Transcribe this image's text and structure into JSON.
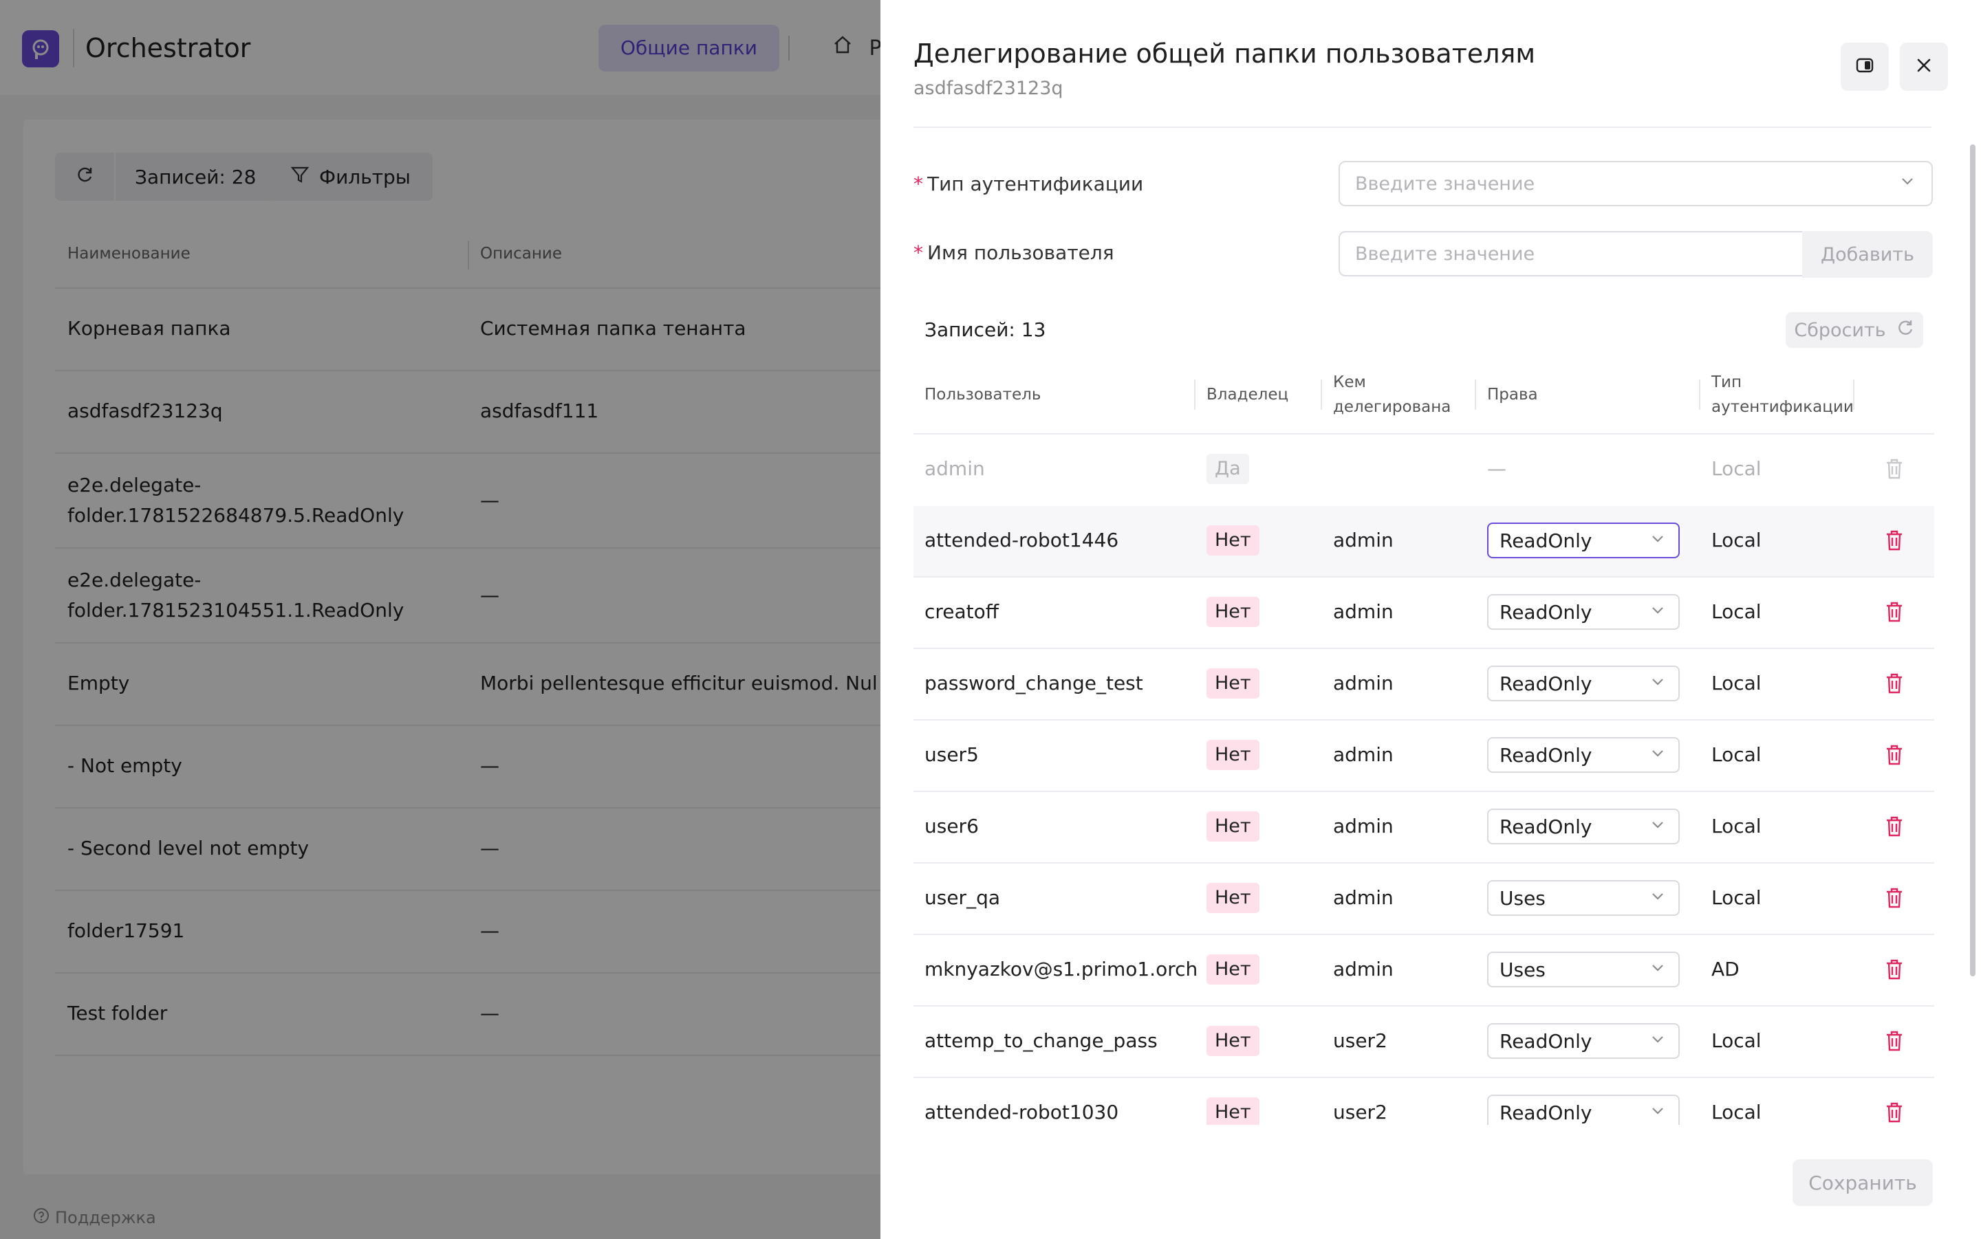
{
  "app": {
    "brand": "Orchestrator",
    "nav_active": "Общие папки",
    "nav_home_partial": "Р",
    "toolbar": {
      "records": "Записей: 28",
      "filters": "Фильтры"
    },
    "table": {
      "col_name": "Наименование",
      "col_desc": "Описание",
      "rows": [
        {
          "name": "Корневая папка",
          "desc": "Системная папка тенанта"
        },
        {
          "name": "asdfasdf23123q",
          "desc": "asdfasdf111"
        },
        {
          "name": "e2e.delegate-folder.1781522684879.5.ReadOnly",
          "desc": "—"
        },
        {
          "name": "e2e.delegate-folder.1781523104551.1.ReadOnly",
          "desc": "—"
        },
        {
          "name": "Empty",
          "desc": "Morbi pellentesque efficitur euismod. Nullam p"
        },
        {
          "name": "- Not empty",
          "desc": "—"
        },
        {
          "name": "- Second level not empty",
          "desc": "—"
        },
        {
          "name": "folder17591",
          "desc": "—"
        },
        {
          "name": "Test folder",
          "desc": "—"
        }
      ]
    },
    "support": "Поддержка"
  },
  "drawer": {
    "title": "Делегирование общей папки пользователям",
    "subtitle": "asdfasdf23123q",
    "form": {
      "auth_label": "Тип аутентификации",
      "auth_placeholder": "Введите значение",
      "user_label": "Имя пользователя",
      "user_placeholder": "Введите значение",
      "add_label": "Добавить"
    },
    "records": "Записей: 13",
    "reset_label": "Сбросить",
    "columns": {
      "user": "Пользователь",
      "owner": "Владелец",
      "delegated_1": "Кем",
      "delegated_2": "делегирована",
      "rights": "Права",
      "auth_1": "Тип",
      "auth_2": "аутентификации"
    },
    "rows": [
      {
        "user": "admin",
        "owner": "Да",
        "delegated_by": "",
        "rights": "—",
        "auth": "Local"
      },
      {
        "user": "attended-robot1446",
        "owner": "Нет",
        "delegated_by": "admin",
        "rights": "ReadOnly",
        "auth": "Local"
      },
      {
        "user": "creatoff",
        "owner": "Нет",
        "delegated_by": "admin",
        "rights": "ReadOnly",
        "auth": "Local"
      },
      {
        "user": "password_change_test",
        "owner": "Нет",
        "delegated_by": "admin",
        "rights": "ReadOnly",
        "auth": "Local"
      },
      {
        "user": "user5",
        "owner": "Нет",
        "delegated_by": "admin",
        "rights": "ReadOnly",
        "auth": "Local"
      },
      {
        "user": "user6",
        "owner": "Нет",
        "delegated_by": "admin",
        "rights": "ReadOnly",
        "auth": "Local"
      },
      {
        "user": "user_qa",
        "owner": "Нет",
        "delegated_by": "admin",
        "rights": "Uses",
        "auth": "Local"
      },
      {
        "user": "mknyazkov@s1.primo1.orch",
        "owner": "Нет",
        "delegated_by": "admin",
        "rights": "Uses",
        "auth": "AD"
      },
      {
        "user": "attemp_to_change_pass",
        "owner": "Нет",
        "delegated_by": "user2",
        "rights": "ReadOnly",
        "auth": "Local"
      },
      {
        "user": "attended-robot1030",
        "owner": "Нет",
        "delegated_by": "user2",
        "rights": "ReadOnly",
        "auth": "Local"
      }
    ],
    "save_label": "Сохранить",
    "colors": {
      "accent": "#6a4bdc",
      "danger": "#e0245e",
      "owner_badge": "#fde0ea"
    }
  }
}
